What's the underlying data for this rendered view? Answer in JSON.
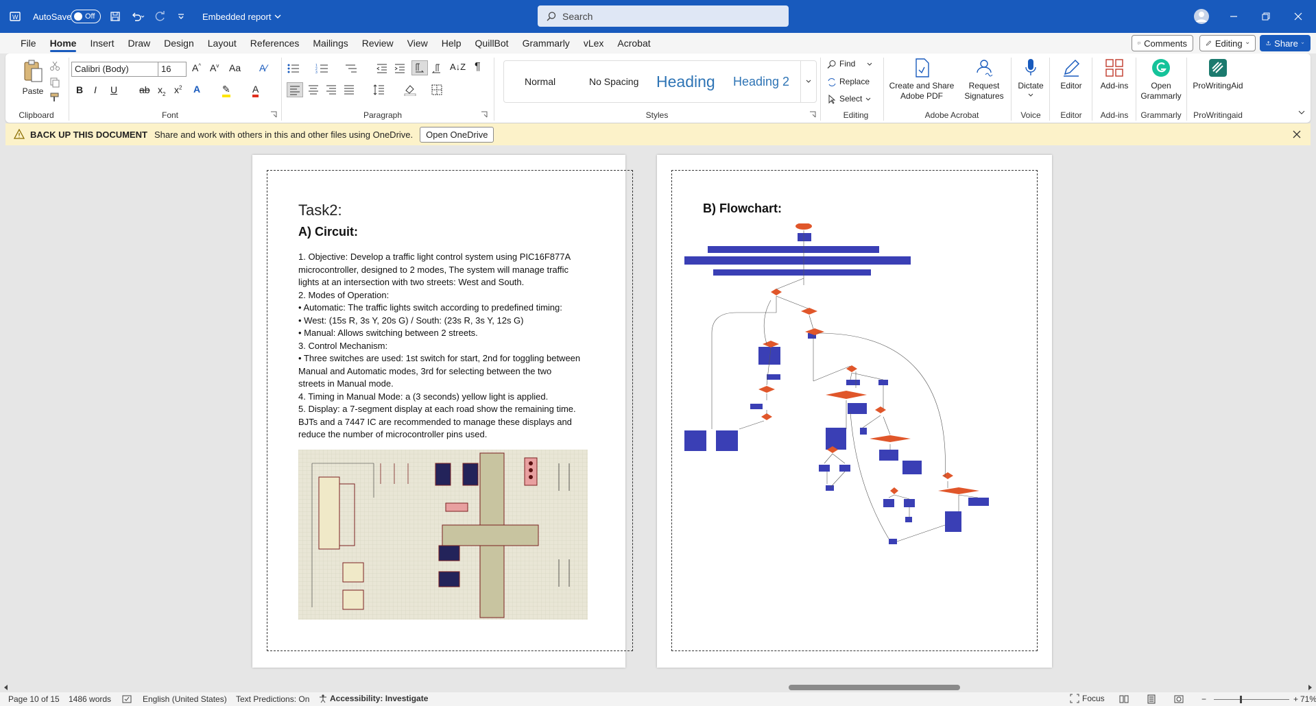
{
  "titlebar": {
    "autosave_label": "AutoSave",
    "autosave_state": "Off",
    "doc_title": "Embedded report",
    "search_placeholder": "Search",
    "bg_color": "#185abd"
  },
  "menu": [
    "File",
    "Home",
    "Insert",
    "Draw",
    "Design",
    "Layout",
    "References",
    "Mailings",
    "Review",
    "View",
    "Help",
    "QuillBot",
    "Grammarly",
    "vLex",
    "Acrobat"
  ],
  "menu_active": "Home",
  "top_buttons": {
    "comments": "Comments",
    "editing": "Editing",
    "share": "Share"
  },
  "ribbon": {
    "clipboard": {
      "paste": "Paste",
      "label": "Clipboard"
    },
    "font": {
      "name": "Calibri (Body)",
      "size": "16",
      "label": "Font"
    },
    "paragraph": {
      "label": "Paragraph"
    },
    "styles": {
      "items": [
        "Normal",
        "No Spacing",
        "Heading",
        "Heading 2"
      ],
      "label": "Styles"
    },
    "editing": {
      "find": "Find",
      "replace": "Replace",
      "select": "Select",
      "label": "Editing"
    },
    "acrobat": {
      "create": "Create and Share",
      "create2": "Adobe PDF",
      "request": "Request",
      "request2": "Signatures",
      "label": "Adobe Acrobat"
    },
    "voice": {
      "dictate": "Dictate",
      "label": "Voice"
    },
    "editor": {
      "editor": "Editor",
      "label": "Editor"
    },
    "addins": {
      "addins": "Add-ins",
      "label": "Add-ins"
    },
    "grammarly": {
      "open": "Open",
      "open2": "Grammarly",
      "label": "Grammarly"
    },
    "prowriting": {
      "name": "ProWritingAid",
      "label": "ProWritingaid"
    }
  },
  "notice": {
    "title": "BACK UP THIS DOCUMENT",
    "message": "Share and work with others in this and other files using OneDrive.",
    "button": "Open OneDrive"
  },
  "page1": {
    "title": "Task2:",
    "heading": "A) Circuit:",
    "lines": [
      "1. Objective: Develop a traffic light control system using PIC16F877A",
      "microcontroller, designed to 2 modes, The system will manage traffic",
      "lights at an intersection with two streets: West and South.",
      "2. Modes of Operation:",
      "• Automatic: The traffic lights switch according to predefined timing:",
      "• West: (15s R, 3s Y, 20s G) / South: (23s R, 3s Y, 12s G)",
      "• Manual: Allows switching between 2 streets.",
      "3. Control Mechanism:",
      "• Three switches are used: 1st switch for start, 2nd for toggling between",
      "Manual and Automatic modes, 3rd for selecting between the two",
      "streets in Manual mode.",
      "4. Timing in Manual Mode: a (3 seconds) yellow light is applied.",
      "5. Display: a 7-segment display at each road show the remaining time.",
      "BJTs and a 7447 IC are recommended to manage these displays and",
      "reduce the number of microcontroller pins used."
    ]
  },
  "page2": {
    "heading": "B) Flowchart:"
  },
  "status": {
    "page": "Page 10 of 15",
    "words": "1486 words",
    "language": "English (United States)",
    "predictions": "Text Predictions: On",
    "accessibility": "Accessibility: Investigate",
    "focus": "Focus",
    "zoom": "71%"
  }
}
